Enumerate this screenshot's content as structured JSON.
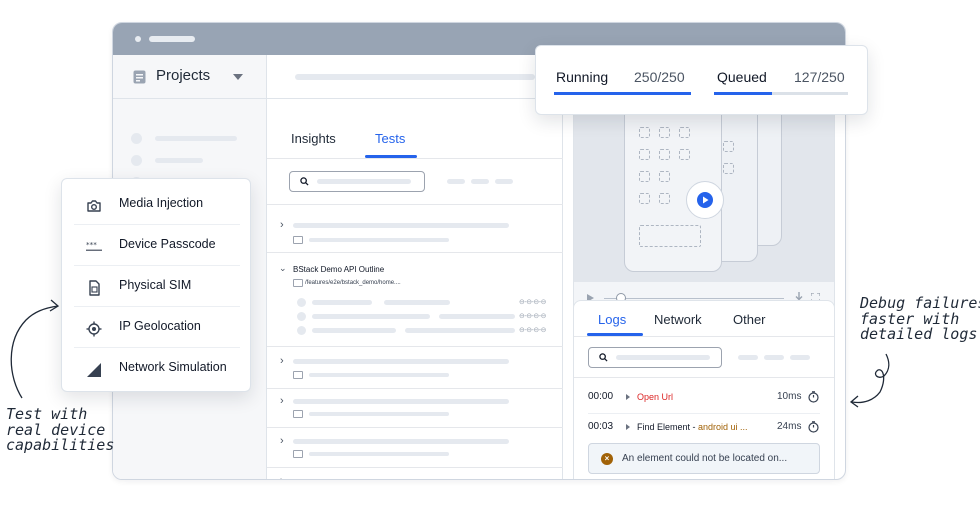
{
  "sidebar": {
    "projects_label": "Projects"
  },
  "tests_panel": {
    "tabs": [
      {
        "label": "Insights"
      },
      {
        "label": "Tests"
      }
    ],
    "outline": {
      "title": "BStack Demo API Outline",
      "path": "/features/e2e/bstack_demo/home...."
    }
  },
  "run_status": {
    "running": {
      "label": "Running",
      "value": "250/250",
      "progress": 1.0
    },
    "queued": {
      "label": "Queued",
      "value": "127/250",
      "progress": 0.43
    }
  },
  "logs_panel": {
    "tabs": [
      {
        "label": "Logs"
      },
      {
        "label": "Network"
      },
      {
        "label": "Other"
      }
    ],
    "entries": [
      {
        "time": "00:00",
        "action": "Open Url",
        "detail": "",
        "duration": "10ms"
      },
      {
        "time": "00:03",
        "action": "Find Element - ",
        "detail": "android ui ...",
        "duration": "24ms"
      }
    ],
    "error": "An element could not be located on..."
  },
  "capabilities": [
    {
      "label": "Media Injection",
      "icon": "camera-icon"
    },
    {
      "label": "Device Passcode",
      "icon": "passcode-icon"
    },
    {
      "label": "Physical SIM",
      "icon": "sim-card-icon"
    },
    {
      "label": "IP Geolocation",
      "icon": "geolocation-icon"
    },
    {
      "label": "Network Simulation",
      "icon": "signal-icon"
    }
  ],
  "annotations": {
    "left": [
      "Test with",
      "real device",
      "capabilities"
    ],
    "right": [
      "Debug failures",
      "faster with",
      "detailed logs"
    ]
  },
  "colors": {
    "accent": "#2563eb",
    "error_text": "#dc2626",
    "highlight_text": "#a16207",
    "titlebar": "#98a4b4"
  }
}
